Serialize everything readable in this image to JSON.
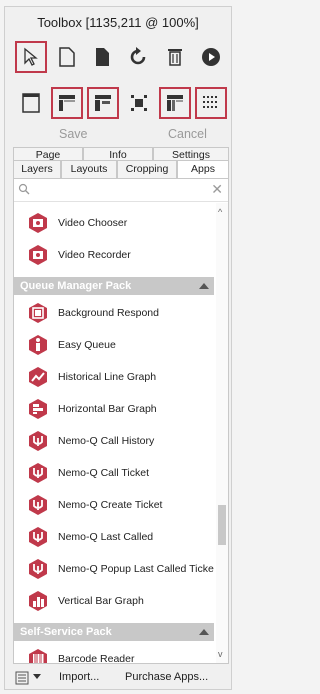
{
  "window": {
    "title": "Toolbox [1135,211 @ 100%]"
  },
  "toolbar": {
    "row1": [
      {
        "icon": "pointer-icon",
        "selected": true
      },
      {
        "icon": "new-page-icon",
        "selected": false
      },
      {
        "icon": "copy-page-icon",
        "selected": false
      },
      {
        "icon": "undo-icon",
        "selected": false
      },
      {
        "icon": "delete-icon",
        "selected": false
      },
      {
        "icon": "play-icon",
        "selected": false
      }
    ],
    "row2": [
      {
        "icon": "single-page-icon",
        "selected": false
      },
      {
        "icon": "layout-grid-a-icon",
        "selected": true
      },
      {
        "icon": "layout-grid-b-icon",
        "selected": true
      },
      {
        "icon": "layout-grid-c-icon",
        "selected": false
      },
      {
        "icon": "layout-grid-d-icon",
        "selected": true
      },
      {
        "icon": "dot-grid-icon",
        "selected": true
      }
    ],
    "save_label": "Save",
    "cancel_label": "Cancel"
  },
  "tabs": {
    "row1": [
      "Page",
      "Info",
      "Settings"
    ],
    "row2": [
      "Layers",
      "Layouts",
      "Cropping",
      "Apps"
    ],
    "active": "Apps"
  },
  "search": {
    "placeholder": "",
    "value": ""
  },
  "list": [
    {
      "type": "item",
      "label": "Video Chooser",
      "icon": "video-chooser-icon"
    },
    {
      "type": "item",
      "label": "Video Recorder",
      "icon": "video-recorder-icon"
    },
    {
      "type": "section",
      "label": "Queue Manager Pack"
    },
    {
      "type": "item",
      "label": "Background Respond",
      "icon": "background-respond-icon"
    },
    {
      "type": "item",
      "label": "Easy Queue",
      "icon": "easy-queue-icon"
    },
    {
      "type": "item",
      "label": "Historical Line Graph",
      "icon": "line-graph-icon"
    },
    {
      "type": "item",
      "label": "Horizontal Bar Graph",
      "icon": "horizontal-bar-icon"
    },
    {
      "type": "item",
      "label": "Nemo-Q Call History",
      "icon": "nemo-q-icon"
    },
    {
      "type": "item",
      "label": "Nemo-Q Call Ticket",
      "icon": "nemo-q-icon"
    },
    {
      "type": "item",
      "label": "Nemo-Q Create Ticket",
      "icon": "nemo-q-icon"
    },
    {
      "type": "item",
      "label": "Nemo-Q Last Called",
      "icon": "nemo-q-icon"
    },
    {
      "type": "item",
      "label": "Nemo-Q Popup Last Called Ticket",
      "icon": "nemo-q-icon"
    },
    {
      "type": "item",
      "label": "Vertical Bar Graph",
      "icon": "vertical-bar-icon"
    },
    {
      "type": "section",
      "label": "Self-Service Pack"
    },
    {
      "type": "item",
      "label": "Barcode Reader",
      "icon": "barcode-icon"
    }
  ],
  "footer": {
    "import_label": "Import...",
    "purchase_label": "Purchase Apps..."
  },
  "colors": {
    "accent": "#c0394b",
    "section": "#c8c8c8"
  }
}
